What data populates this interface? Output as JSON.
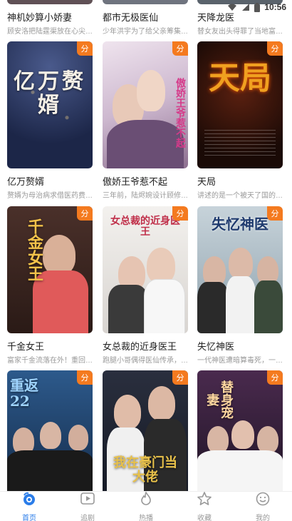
{
  "status_bar": {
    "time": "10:56"
  },
  "rows": [
    {
      "cards": [
        {
          "title": "神机妙算小娇妻",
          "desc": "顾安洛把陆霆渠放在心尖…",
          "poster_text": "",
          "badge": "",
          "bg": "#7a6b70"
        },
        {
          "title": "都市无极医仙",
          "desc": "少年洪宇为了给父亲筹集…",
          "poster_text": "",
          "badge": "",
          "bg": "#8a8f9a"
        },
        {
          "title": "天降龙医",
          "desc": "替女友出头得罪了当地富…",
          "poster_text": "",
          "badge": "",
          "bg": "#6d7780"
        }
      ]
    },
    {
      "cards": [
        {
          "title": "亿万赘婿",
          "desc": "赘婿为母治病求借医药费…",
          "poster_text": "亿万赘婿",
          "badge": "分",
          "bg": "#2b3a66"
        },
        {
          "title": "傲娇王爷惹不起",
          "desc": "三年前，陆烬婉设计顾修…",
          "poster_text": "傲娇王爷惹不起",
          "badge": "分",
          "bg": "#d9c9d8"
        },
        {
          "title": "天局",
          "desc": "讲述的是一个被天了国的…",
          "poster_text": "天局",
          "badge": "分",
          "bg": "#2a1410"
        }
      ]
    },
    {
      "cards": [
        {
          "title": "千金女王",
          "desc": "富家千金流落在外！重回…",
          "poster_text": "千金女王",
          "badge": "分",
          "bg": "#3a2520"
        },
        {
          "title": "女总裁的近身医王",
          "desc": "跑腿小哥偶得医仙传承，…",
          "poster_text": "女总裁的近身医王",
          "badge": "分",
          "bg": "#e9e6e3"
        },
        {
          "title": "失忆神医",
          "desc": "一代神医遭暗算毒死，一…",
          "poster_text": "失忆神医",
          "badge": "分",
          "bg": "#b7c4cc"
        }
      ]
    },
    {
      "cards": [
        {
          "title": "",
          "desc": "",
          "poster_text": "重返22",
          "badge": "分",
          "bg": "#23456e"
        },
        {
          "title": "",
          "desc": "",
          "poster_text": "我在豪门当大佬",
          "badge": "分",
          "bg": "#1d2230"
        },
        {
          "title": "",
          "desc": "",
          "poster_text": "替身宠妻",
          "badge": "分",
          "bg": "#2c2438"
        }
      ]
    }
  ],
  "tabs": [
    {
      "label": "首页",
      "icon": "home-icon",
      "active": true
    },
    {
      "label": "追剧",
      "icon": "play-icon",
      "active": false
    },
    {
      "label": "热播",
      "icon": "flame-icon",
      "active": false
    },
    {
      "label": "收藏",
      "icon": "star-icon",
      "active": false
    },
    {
      "label": "我的",
      "icon": "smiley-icon",
      "active": false
    }
  ],
  "colors": {
    "accent": "#2b7de9",
    "badge": "#f47a1f"
  }
}
